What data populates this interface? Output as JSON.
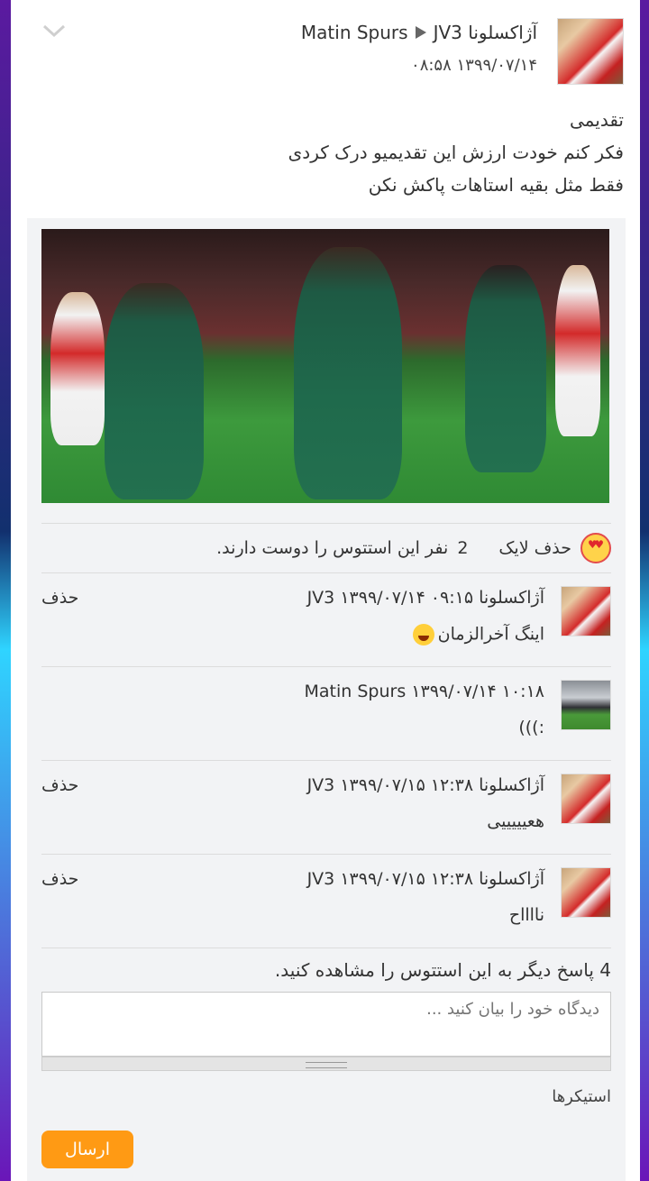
{
  "post": {
    "author": "آژاکسلونا JV3",
    "recipient": "Matin Spurs",
    "date": "۱۳۹۹/۰۷/۱۴ ۰۸:۵۸",
    "lines": [
      "تقدیمی",
      "فکر کنم خودت ارزش این تقدیمیو درک کردی",
      "فقط مثل بقیه استاهات پاکش نکن"
    ],
    "image_icon": "football-celebration-photo"
  },
  "likes": {
    "unlike_label": "حذف لایک",
    "count": "2",
    "text": "نفر این استتوس را دوست دارند.",
    "icon": "heart-eyes-emoji"
  },
  "comments": [
    {
      "author": "آژاکسلونا JV3",
      "date": "۱۳۹۹/۰۷/۱۴ ۰۹:۱۵",
      "text": "اینگ آخرالزمان",
      "emoji": "laughing-emoji",
      "delete_label": "حذف"
    },
    {
      "author": "Matin Spurs",
      "date": "۱۳۹۹/۰۷/۱۴ ۱۰:۱۸",
      "text": ":)))",
      "delete_label": ""
    },
    {
      "author": "آژاکسلونا JV3",
      "date": "۱۳۹۹/۰۷/۱۵ ۱۲:۳۸",
      "text": "هعیییییی",
      "delete_label": "حذف"
    },
    {
      "author": "آژاکسلونا JV3",
      "date": "۱۳۹۹/۰۷/۱۵ ۱۲:۳۸",
      "text": "نااااح",
      "delete_label": "حذف"
    }
  ],
  "more_replies": "4 پاسخ دیگر به این استتوس را مشاهده کنید.",
  "comment_input": {
    "placeholder": "دیدگاه خود را بیان کنید ..."
  },
  "stickers_label": "استیکرها",
  "send_label": "ارسال",
  "colors": {
    "send_button": "#ff9a14",
    "panel": "#f2f3f5"
  }
}
